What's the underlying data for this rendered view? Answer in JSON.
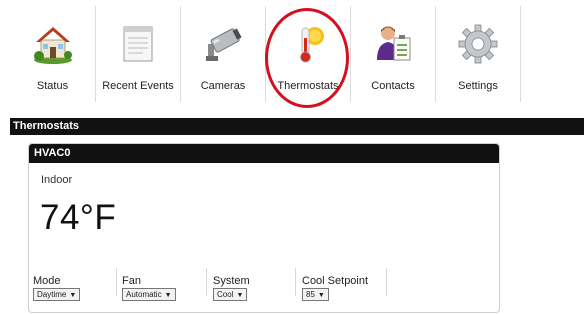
{
  "nav": {
    "items": [
      {
        "label": "Status",
        "icon": "house-icon"
      },
      {
        "label": "Recent Events",
        "icon": "document-icon"
      },
      {
        "label": "Cameras",
        "icon": "camera-icon"
      },
      {
        "label": "Thermostats",
        "icon": "thermometer-icon",
        "highlighted": true
      },
      {
        "label": "Contacts",
        "icon": "contact-card-icon"
      },
      {
        "label": "Settings",
        "icon": "gear-icon"
      }
    ]
  },
  "section": {
    "title": "Thermostats"
  },
  "thermostat": {
    "name": "HVAC0",
    "location_label": "Indoor",
    "temperature": "74°F",
    "controls": {
      "mode": {
        "label": "Mode",
        "value": "Daytime"
      },
      "fan": {
        "label": "Fan",
        "value": "Automatic"
      },
      "system": {
        "label": "System",
        "value": "Cool"
      },
      "cool_setpoint": {
        "label": "Cool Setpoint",
        "value": "85"
      }
    }
  },
  "colors": {
    "highlight_circle": "#d40f1e",
    "header_bar": "#111111"
  },
  "dropdown_arrow": "▼"
}
